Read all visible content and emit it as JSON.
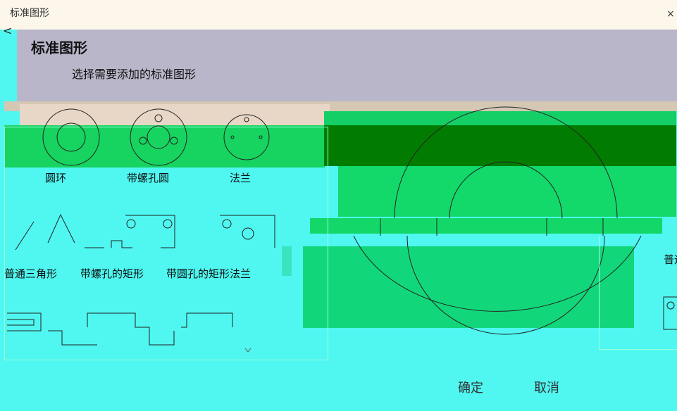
{
  "window": {
    "title": "标准图形",
    "close": "×",
    "back": "<"
  },
  "header": {
    "title": "标准图形",
    "subtitle": "选择需要添加的标准图形"
  },
  "gallery": {
    "items": [
      {
        "label": "圆环"
      },
      {
        "label": "带螺孔圆"
      },
      {
        "label": "法兰"
      },
      {
        "label": "普通三角形"
      },
      {
        "label": "带螺孔的矩形"
      },
      {
        "label": "带圆孔的矩形法兰"
      },
      {
        "label": ""
      },
      {
        "label": ""
      },
      {
        "label": ""
      }
    ]
  },
  "side": {
    "partial_label": "普通"
  },
  "buttons": {
    "ok": "确定",
    "cancel": "取消"
  },
  "colors": {
    "background": "#4ff7f0",
    "header": "#bab6c9",
    "green": "#15cf62",
    "dark_green": "#028000",
    "titlebar": "#fdf6ea"
  }
}
